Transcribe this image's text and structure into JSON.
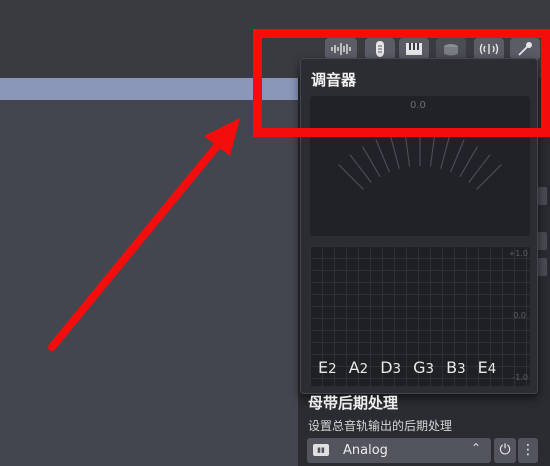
{
  "toolbar": {
    "icons": [
      "waveform-icon",
      "guitar-icon",
      "piano-icon",
      "drum-icon",
      "tuner-icon",
      "microphone-icon"
    ]
  },
  "tuner": {
    "title": "调音器",
    "meter_zero": "0.0",
    "meter_neg": "-1.0",
    "meter_pos": "+1.0",
    "graph_labels": [
      "+1.0",
      "0.0",
      "-1.0"
    ],
    "strings": [
      {
        "note": "E",
        "octave": "2"
      },
      {
        "note": "A",
        "octave": "2"
      },
      {
        "note": "D",
        "octave": "3"
      },
      {
        "note": "G",
        "octave": "3"
      },
      {
        "note": "B",
        "octave": "3"
      },
      {
        "note": "E",
        "octave": "4"
      }
    ]
  },
  "mastering": {
    "title": "母带后期处理",
    "subtitle": "设置总音轨输出的后期处理",
    "preset_value": "Analog",
    "power_label": "⏻",
    "more_label": "⋮"
  },
  "colors": {
    "highlight": "#f40d0d",
    "arrow": "#f40d0d"
  }
}
